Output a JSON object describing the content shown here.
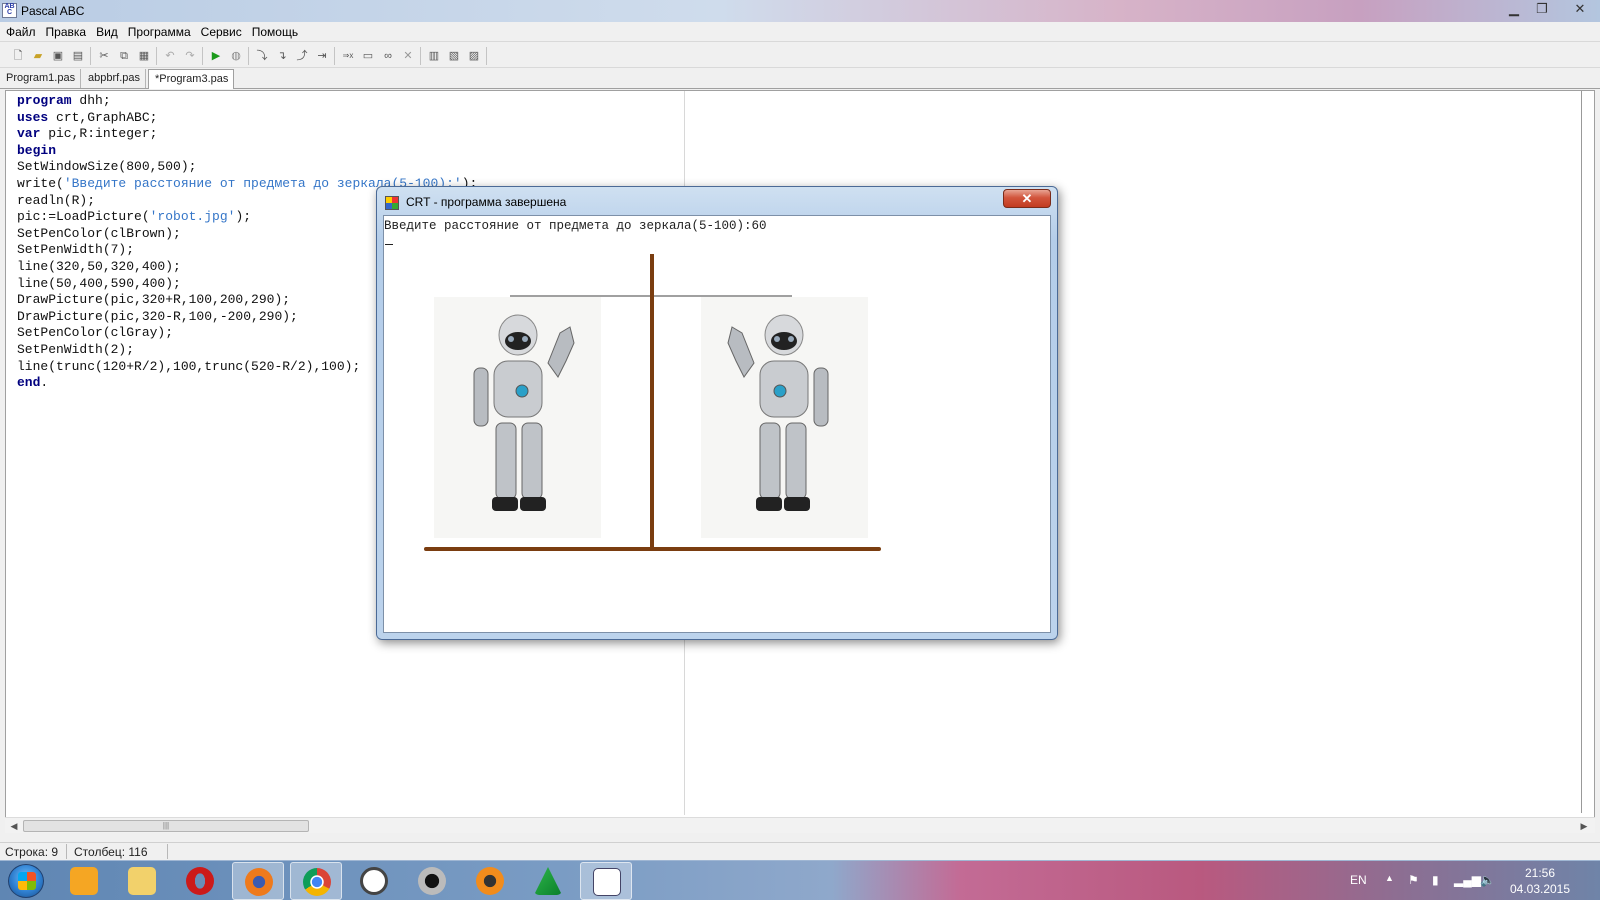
{
  "window": {
    "title": "Pascal ABC",
    "icon_text": "AB\nC"
  },
  "menu": [
    "Файл",
    "Правка",
    "Вид",
    "Программа",
    "Сервис",
    "Помощь"
  ],
  "tabs": [
    {
      "label": "Program1.pas",
      "active": false
    },
    {
      "label": "abpbrf.pas",
      "active": false
    },
    {
      "label": "*Program3.pas",
      "active": true
    }
  ],
  "code": [
    [
      [
        "kw",
        "program"
      ],
      [
        "txt",
        " dhh;"
      ]
    ],
    [
      [
        "kw",
        "uses"
      ],
      [
        "txt",
        " crt,GraphABC;"
      ]
    ],
    [
      [
        "kw",
        "var"
      ],
      [
        "txt",
        " pic,R:integer;"
      ]
    ],
    [
      [
        "kw",
        "begin"
      ]
    ],
    [
      [
        "txt",
        "SetWindowSize(800,500);"
      ]
    ],
    [
      [
        "txt",
        "write("
      ],
      [
        "str",
        "'Введите расстояние от предмета до зеркала(5-100):'"
      ],
      [
        "txt",
        ");"
      ]
    ],
    [
      [
        "txt",
        "readln(R);"
      ]
    ],
    [
      [
        "txt",
        "pic:=LoadPicture("
      ],
      [
        "str",
        "'robot.jpg'"
      ],
      [
        "txt",
        ");"
      ]
    ],
    [
      [
        "txt",
        "SetPenColor(clBrown);"
      ]
    ],
    [
      [
        "txt",
        "SetPenWidth(7);"
      ]
    ],
    [
      [
        "txt",
        "line(320,50,320,400);"
      ]
    ],
    [
      [
        "txt",
        "line(50,400,590,400);"
      ]
    ],
    [
      [
        "txt",
        "DrawPicture(pic,320+R,100,200,290);"
      ]
    ],
    [
      [
        "txt",
        "DrawPicture(pic,320-R,100,-200,290);"
      ]
    ],
    [
      [
        "txt",
        "SetPenColor(clGray);"
      ]
    ],
    [
      [
        "txt",
        "SetPenWidth(2);"
      ]
    ],
    [
      [
        "txt",
        "line(trunc(120+R/2),100,trunc(520-R/2),100);"
      ]
    ],
    [
      [
        "kw",
        "end"
      ],
      [
        "txt",
        "."
      ]
    ]
  ],
  "status": {
    "row": "Строка: 9",
    "col": "Столбец: 116"
  },
  "crt": {
    "title": "CRT - программа завершена",
    "console_line": "Введите расстояние от предмета до зеркала(5-100):60",
    "close_label": "✕"
  },
  "taskbar": {
    "apps": [
      "media-player-icon",
      "file-explorer-icon",
      "opera-icon",
      "firefox-icon",
      "chrome-icon",
      "app-circle-icon",
      "camera-icon",
      "avast-icon",
      "a-green-icon",
      "pascal-abc-icon"
    ],
    "lang": "EN",
    "time": "21:56",
    "date": "04.03.2015"
  },
  "colors": {
    "keyword": "#00007f",
    "string": "#3576c8",
    "brown_pen": "#7a3d10",
    "gray_pen": "#808080"
  }
}
